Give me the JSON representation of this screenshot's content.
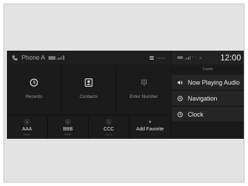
{
  "status": {
    "phone_name": "Phone A",
    "menu_label": "MENU",
    "clock": "12:00"
  },
  "main_tiles": [
    {
      "label": "Recents",
      "icon": "clock-icon"
    },
    {
      "label": "Contacts",
      "icon": "contact-card-icon"
    },
    {
      "label": "Enter Number",
      "icon": "keypad-icon"
    }
  ],
  "favorites": [
    {
      "badge": "A",
      "name": "AAA",
      "sub": "Mobile"
    },
    {
      "badge": "B",
      "name": "BBB",
      "sub": "Mobile"
    },
    {
      "badge": "C",
      "name": "CCC",
      "sub": "Home"
    }
  ],
  "add_favorite": {
    "label": "Add Favorite",
    "sign": "+"
  },
  "cards": {
    "title": "Cards",
    "items": [
      {
        "label": "Now Playing Audio",
        "icon": "speaker-icon"
      },
      {
        "label": "Navigation",
        "icon": "navigation-icon"
      },
      {
        "label": "Clock",
        "icon": "clock-icon"
      }
    ]
  }
}
